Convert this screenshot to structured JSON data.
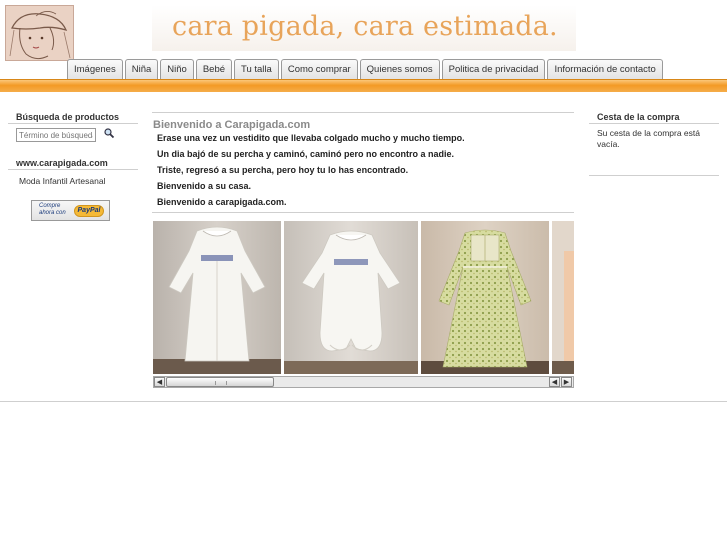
{
  "header": {
    "logo_icon": "girl-with-hat-illustration",
    "banner_text": "cara pigada, cara estimada."
  },
  "nav": {
    "tabs": [
      {
        "label": "Imágenes"
      },
      {
        "label": "Niña"
      },
      {
        "label": "Niño"
      },
      {
        "label": "Bebé"
      },
      {
        "label": "Tu talla"
      },
      {
        "label": "Como comprar"
      },
      {
        "label": "Quienes somos"
      },
      {
        "label": "Politica de privacidad"
      },
      {
        "label": "Información de contacto"
      }
    ]
  },
  "sidebar": {
    "search_title": "Búsqueda de productos",
    "search_placeholder": "Término de búsqueda",
    "search_icon": "magnifier-icon",
    "site_title": "www.carapigada.com",
    "site_link": "Moda Infantil Artesanal",
    "paypal_small": "Compre ahora con",
    "paypal_logo": "PayPal"
  },
  "main": {
    "title": "Bienvenido a Carapigada.com",
    "lines": [
      "Erase una vez un vestidito que llevaba colgado mucho y mucho tiempo.",
      "Un dia bajó de su percha y caminó, caminó pero no encontro a nadie.",
      "Triste, regresó a su percha, pero hoy tu lo has encontrado.",
      "Bienvenido a su casa.",
      "Bienvenido a carapigada.com."
    ],
    "gallery": [
      "white-smocked-dress-photo",
      "white-smocked-romper-photo",
      "floral-green-dress-photo",
      "partial-photo"
    ]
  },
  "cart": {
    "title": "Cesta de la compra",
    "text": "Su cesta de la compra está vacía."
  },
  "colors": {
    "accent_orange": "#f39a25",
    "banner_text": "#e8a45a"
  }
}
